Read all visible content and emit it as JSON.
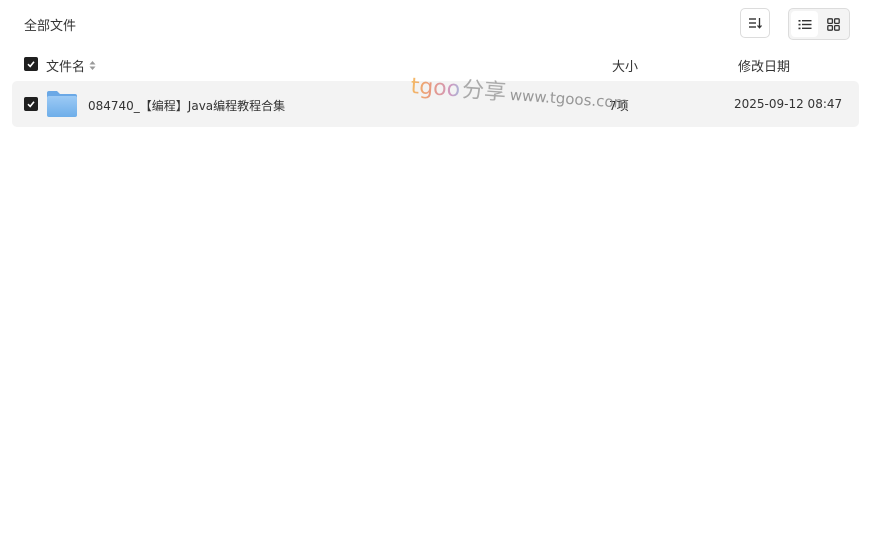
{
  "header": {
    "title": "全部文件"
  },
  "toolbar": {
    "sort_icon": "sort-icon",
    "view_list_icon": "list-view-icon",
    "view_grid_icon": "grid-view-icon",
    "active_view": "list"
  },
  "columns": {
    "name": "文件名",
    "size": "大小",
    "date": "修改日期"
  },
  "files": [
    {
      "name": "084740_【编程】Java编程教程合集",
      "size": "7项",
      "date": "2025-09-12 08:47",
      "icon": "folder-icon",
      "checked": true
    }
  ],
  "watermark": {
    "brand": "tgoo",
    "cn": "分享",
    "url": "www.tgoos.com"
  },
  "colors": {
    "checkbox": "#1f1f1f",
    "row_bg": "#f3f3f3",
    "folder": "#7fb8f0"
  }
}
